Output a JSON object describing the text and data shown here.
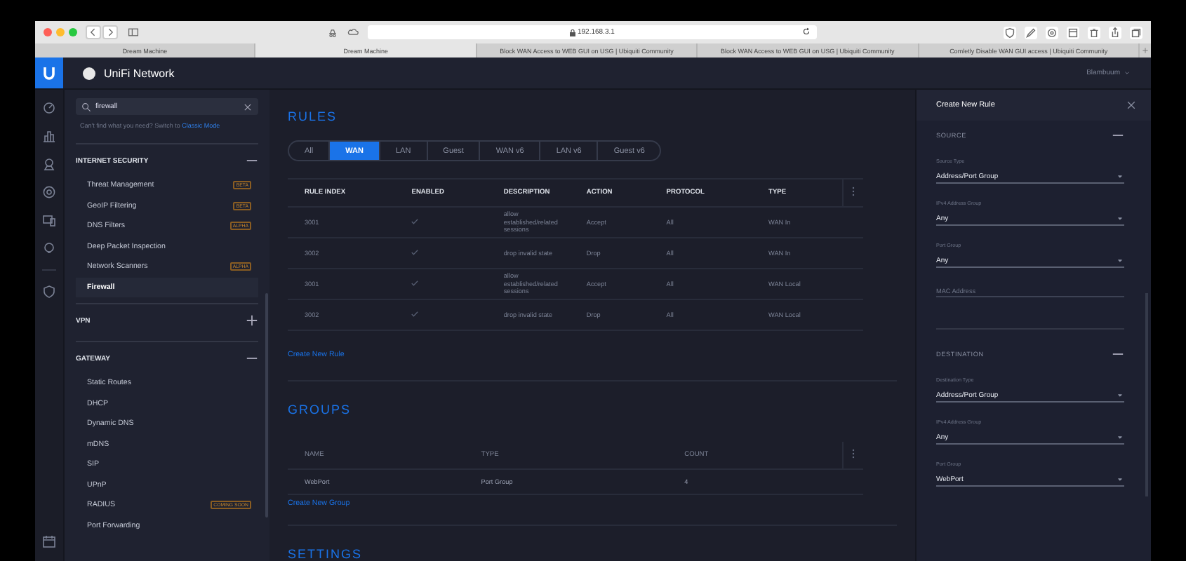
{
  "browser": {
    "url": "192.168.3.1",
    "tabs": [
      {
        "label": "Dream Machine",
        "selected": false
      },
      {
        "label": "Dream Machine",
        "selected": true
      },
      {
        "label": "Block WAN Access to WEB GUI on USG | Ubiquiti Community",
        "selected": false
      },
      {
        "label": "Block WAN Access to WEB GUI on USG | Ubiquiti Community",
        "selected": false
      },
      {
        "label": "Comletly Disable WAN GUI access | Ubiquiti Community",
        "selected": false
      }
    ]
  },
  "header": {
    "product": "UniFi Network",
    "user": "Blambuum"
  },
  "sidebar": {
    "search": {
      "value": "firewall"
    },
    "hint": "Can't find what you need? Switch to",
    "hint_link": "Classic Mode",
    "sections": [
      {
        "title": "INTERNET SECURITY",
        "expanded": true,
        "items": [
          {
            "label": "Threat Management",
            "badge": "BETA",
            "selected": false
          },
          {
            "label": "GeoIP Filtering",
            "badge": "BETA",
            "selected": false
          },
          {
            "label": "DNS Filters",
            "badge": "ALPHA",
            "selected": false
          },
          {
            "label": "Deep Packet Inspection",
            "selected": false
          },
          {
            "label": "Network Scanners",
            "badge": "ALPHA",
            "selected": false
          },
          {
            "label": "Firewall",
            "selected": true
          }
        ]
      },
      {
        "title": "VPN",
        "expanded": false
      },
      {
        "title": "GATEWAY",
        "expanded": true,
        "items": [
          {
            "label": "Static Routes",
            "selected": false
          },
          {
            "label": "DHCP",
            "selected": false
          },
          {
            "label": "Dynamic DNS",
            "selected": false
          },
          {
            "label": "mDNS",
            "selected": false
          },
          {
            "label": "SIP",
            "selected": false
          },
          {
            "label": "UPnP",
            "selected": false
          },
          {
            "label": "RADIUS",
            "badge": "COMING SOON",
            "selected": false
          },
          {
            "label": "Port Forwarding",
            "selected": false
          }
        ]
      }
    ]
  },
  "rules": {
    "title": "RULES",
    "filters": [
      {
        "label": "All",
        "selected": false
      },
      {
        "label": "WAN",
        "selected": true
      },
      {
        "label": "LAN",
        "selected": false
      },
      {
        "label": "Guest",
        "selected": false
      },
      {
        "label": "WAN v6",
        "selected": false
      },
      {
        "label": "LAN v6",
        "selected": false
      },
      {
        "label": "Guest v6",
        "selected": false
      }
    ],
    "columns": [
      "RULE INDEX",
      "ENABLED",
      "DESCRIPTION",
      "ACTION",
      "PROTOCOL",
      "TYPE"
    ],
    "rows": [
      {
        "index": "3001",
        "enabled": true,
        "description": "allow established/related sessions",
        "action": "Accept",
        "protocol": "All",
        "type": "WAN In"
      },
      {
        "index": "3002",
        "enabled": true,
        "description": "drop invalid state",
        "action": "Drop",
        "protocol": "All",
        "type": "WAN In"
      },
      {
        "index": "3001",
        "enabled": true,
        "description": "allow established/related sessions",
        "action": "Accept",
        "protocol": "All",
        "type": "WAN Local"
      },
      {
        "index": "3002",
        "enabled": true,
        "description": "drop invalid state",
        "action": "Drop",
        "protocol": "All",
        "type": "WAN Local"
      }
    ],
    "create": "Create New Rule"
  },
  "groups": {
    "title": "GROUPS",
    "columns": [
      "NAME",
      "TYPE",
      "COUNT"
    ],
    "rows": [
      {
        "name": "WebPort",
        "type": "Port Group",
        "count": "4"
      }
    ],
    "create": "Create New Group"
  },
  "settings": {
    "title": "SETTINGS"
  },
  "panel": {
    "title": "Create New Rule",
    "sections": [
      {
        "title": "SOURCE",
        "expanded": true,
        "fields": [
          {
            "kind": "select",
            "label": "Source Type",
            "value": "Address/Port Group"
          },
          {
            "kind": "select",
            "label": "IPv4 Address Group",
            "value": "Any"
          },
          {
            "kind": "select",
            "label": "Port Group",
            "value": "Any"
          },
          {
            "kind": "input",
            "placeholder": "MAC Address"
          }
        ]
      },
      {
        "title": "DESTINATION",
        "expanded": true,
        "fields": [
          {
            "kind": "select",
            "label": "Destination Type",
            "value": "Address/Port Group"
          },
          {
            "kind": "select",
            "label": "IPv4 Address Group",
            "value": "Any"
          },
          {
            "kind": "select",
            "label": "Port Group",
            "value": "WebPort"
          }
        ]
      }
    ]
  }
}
